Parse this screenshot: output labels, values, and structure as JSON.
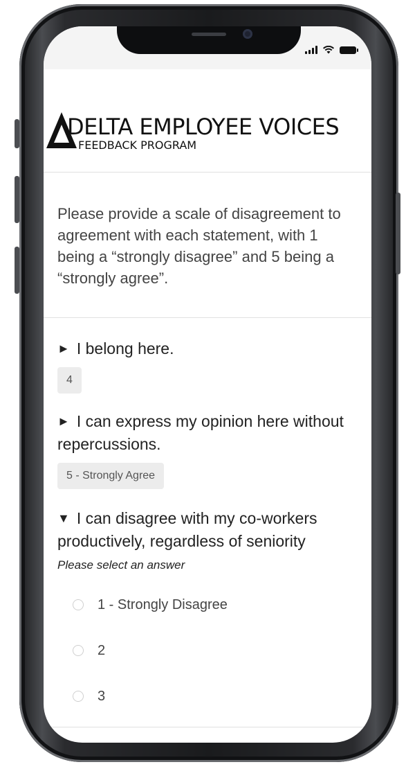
{
  "logo": {
    "title": "DELTA EMPLOYEE VOICES",
    "subtitle": "FEEDBACK PROGRAM"
  },
  "intro": {
    "text": "Please provide a scale of disagreement to agreement with each statement, with 1 being a “strongly disagree” and 5 being a “strongly agree”."
  },
  "questions": [
    {
      "arrow": "►",
      "text": "I belong here.",
      "answer": "4"
    },
    {
      "arrow": "►",
      "text": "I can express my opinion here without repercussions.",
      "answer": "5 - Strongly Agree"
    },
    {
      "arrow": "▼",
      "text": "I can disagree with my co-workers productively, regardless of seniority",
      "hint": "Please select an answer",
      "options": [
        "1 - Strongly Disagree",
        "2",
        "3"
      ]
    }
  ],
  "colors": {
    "text": "#444444",
    "chip": "#ececec",
    "frame": "#1c1d1f"
  }
}
